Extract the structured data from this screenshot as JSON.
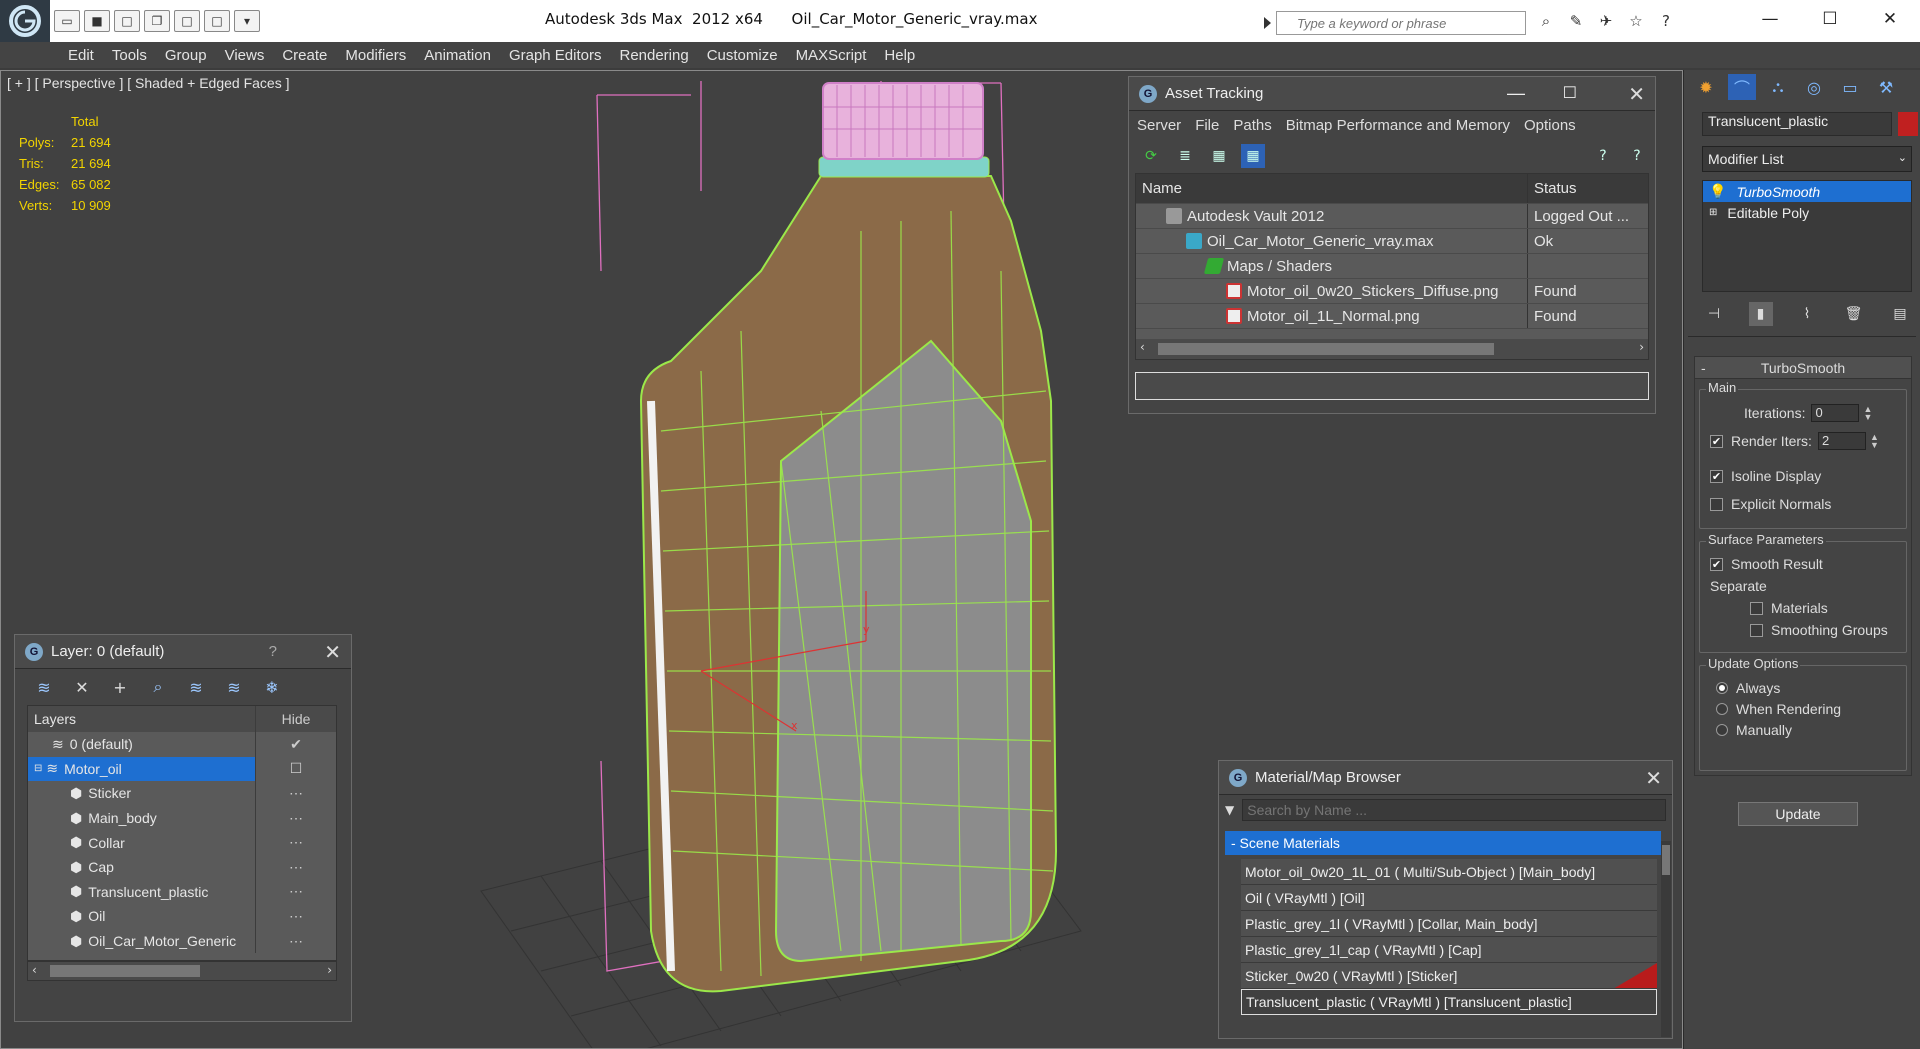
{
  "app": {
    "title": "Autodesk 3ds Max  2012 x64      Oil_Car_Motor_Generic_vray.max",
    "search_placeholder": "Type a keyword or phrase"
  },
  "menu": [
    "Edit",
    "Tools",
    "Group",
    "Views",
    "Create",
    "Modifiers",
    "Animation",
    "Graph Editors",
    "Rendering",
    "Customize",
    "MAXScript",
    "Help"
  ],
  "viewport": {
    "label": "[ + ] [ Perspective ] [ Shaded + Edged Faces ]",
    "stats": {
      "header": "Total",
      "rows": [
        {
          "label": "Polys:",
          "value": "21 694"
        },
        {
          "label": "Tris:",
          "value": "21 694"
        },
        {
          "label": "Edges:",
          "value": "65 082"
        },
        {
          "label": "Verts:",
          "value": "10 909"
        }
      ]
    }
  },
  "asset_tracking": {
    "title": "Asset Tracking",
    "menu": [
      "Server",
      "File",
      "Paths",
      "Bitmap Performance and Memory",
      "Options"
    ],
    "columns": [
      "Name",
      "Status"
    ],
    "rows": [
      {
        "name": "Autodesk Vault 2012",
        "status": "Logged Out ..."
      },
      {
        "name": "Oil_Car_Motor_Generic_vray.max",
        "status": "Ok"
      },
      {
        "name": "Maps / Shaders",
        "status": ""
      },
      {
        "name": "Motor_oil_0w20_Stickers_Diffuse.png",
        "status": "Found"
      },
      {
        "name": "Motor_oil_1L_Normal.png",
        "status": "Found"
      }
    ]
  },
  "layer_panel": {
    "title": "Layer: 0 (default)",
    "help": "?",
    "columns": [
      "Layers",
      "Hide"
    ],
    "rows": [
      {
        "name": "0 (default)"
      },
      {
        "name": "Motor_oil"
      },
      {
        "name": "Sticker"
      },
      {
        "name": "Main_body"
      },
      {
        "name": "Collar"
      },
      {
        "name": "Cap"
      },
      {
        "name": "Translucent_plastic"
      },
      {
        "name": "Oil"
      },
      {
        "name": "Oil_Car_Motor_Generic"
      }
    ]
  },
  "material_browser": {
    "title": "Material/Map Browser",
    "search_placeholder": "Search by Name ...",
    "group": "- Scene Materials",
    "items": [
      "Motor_oil_0w20_1L_01  ( Multi/Sub-Object ) [Main_body]",
      "Oil  ( VRayMtl ) [Oil]",
      "Plastic_grey_1l  ( VRayMtl ) [Collar, Main_body]",
      "Plastic_grey_1l_cap  ( VRayMtl ) [Cap]",
      "Sticker_0w20  ( VRayMtl ) [Sticker]",
      "Translucent_plastic  ( VRayMtl ) [Translucent_plastic]"
    ]
  },
  "command_panel": {
    "object_name": "Translucent_plastic",
    "object_color": "#c02020",
    "modifier_list": "Modifier List",
    "stack": [
      "TurboSmooth",
      "Editable Poly"
    ],
    "rollout_title": "TurboSmooth",
    "main": {
      "title": "Main",
      "iterations_label": "Iterations:",
      "iterations": "0",
      "render_iters_label": "Render Iters:",
      "render_iters": "2",
      "isoline": "Isoline Display",
      "explicit": "Explicit Normals"
    },
    "surface": {
      "title": "Surface Parameters",
      "smooth": "Smooth Result",
      "separate": "Separate",
      "materials": "Materials",
      "smoothing_groups": "Smoothing Groups"
    },
    "update": {
      "title": "Update Options",
      "always": "Always",
      "when_rendering": "When Rendering",
      "manually": "Manually",
      "button": "Update"
    }
  }
}
